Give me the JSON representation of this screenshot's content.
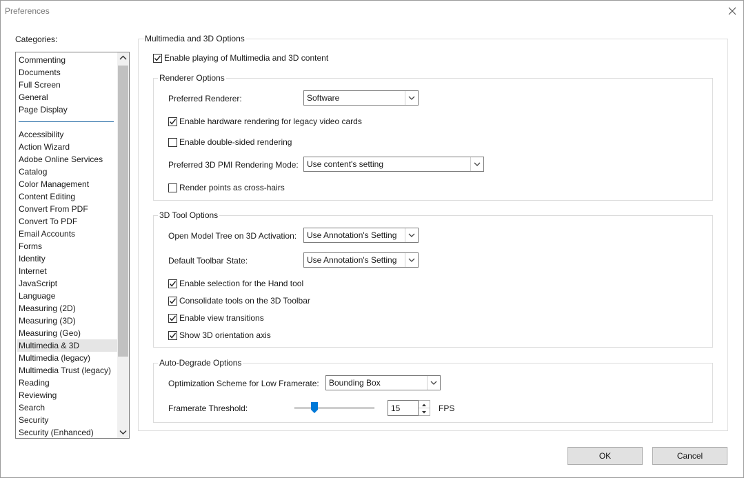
{
  "window": {
    "title": "Preferences"
  },
  "categories": {
    "label": "Categories:",
    "top_items": [
      "Commenting",
      "Documents",
      "Full Screen",
      "General",
      "Page Display"
    ],
    "items": [
      "Accessibility",
      "Action Wizard",
      "Adobe Online Services",
      "Catalog",
      "Color Management",
      "Content Editing",
      "Convert From PDF",
      "Convert To PDF",
      "Email Accounts",
      "Forms",
      "Identity",
      "Internet",
      "JavaScript",
      "Language",
      "Measuring (2D)",
      "Measuring (3D)",
      "Measuring (Geo)",
      "Multimedia & 3D",
      "Multimedia (legacy)",
      "Multimedia Trust (legacy)",
      "Reading",
      "Reviewing",
      "Search",
      "Security",
      "Security (Enhanced)"
    ],
    "selected": "Multimedia & 3D"
  },
  "main": {
    "legend": "Multimedia and 3D Options",
    "enable_playing": {
      "label": "Enable playing of Multimedia and 3D content",
      "checked": true
    }
  },
  "renderer": {
    "legend": "Renderer Options",
    "preferred_renderer_label": "Preferred Renderer:",
    "preferred_renderer_value": "Software",
    "hw_rendering": {
      "label": "Enable hardware rendering for legacy video cards",
      "checked": true
    },
    "double_sided": {
      "label": "Enable double-sided rendering",
      "checked": false
    },
    "pmi_label": "Preferred 3D PMI Rendering Mode:",
    "pmi_value": "Use content's setting",
    "crosshairs": {
      "label": "Render points as cross-hairs",
      "checked": false
    }
  },
  "tool3d": {
    "legend": "3D Tool Options",
    "model_tree_label": "Open Model Tree on 3D Activation:",
    "model_tree_value": "Use Annotation's Setting",
    "toolbar_state_label": "Default Toolbar State:",
    "toolbar_state_value": "Use Annotation's Setting",
    "hand_tool": {
      "label": "Enable selection for the Hand tool",
      "checked": true
    },
    "consolidate": {
      "label": "Consolidate tools on the 3D Toolbar",
      "checked": true
    },
    "view_transitions": {
      "label": "Enable view transitions",
      "checked": true
    },
    "orientation_axis": {
      "label": "Show 3D orientation axis",
      "checked": true
    }
  },
  "degrade": {
    "legend": "Auto-Degrade Options",
    "scheme_label": "Optimization Scheme for Low Framerate:",
    "scheme_value": "Bounding Box",
    "threshold_label": "Framerate Threshold:",
    "threshold_value": "15",
    "threshold_unit": "FPS",
    "slider_level": 0.25
  },
  "buttons": {
    "ok": "OK",
    "cancel": "Cancel"
  },
  "colors": {
    "accent": "#2b6fa8",
    "slider_thumb": "#0078d7",
    "selected_bg": "#e5e5e5"
  }
}
